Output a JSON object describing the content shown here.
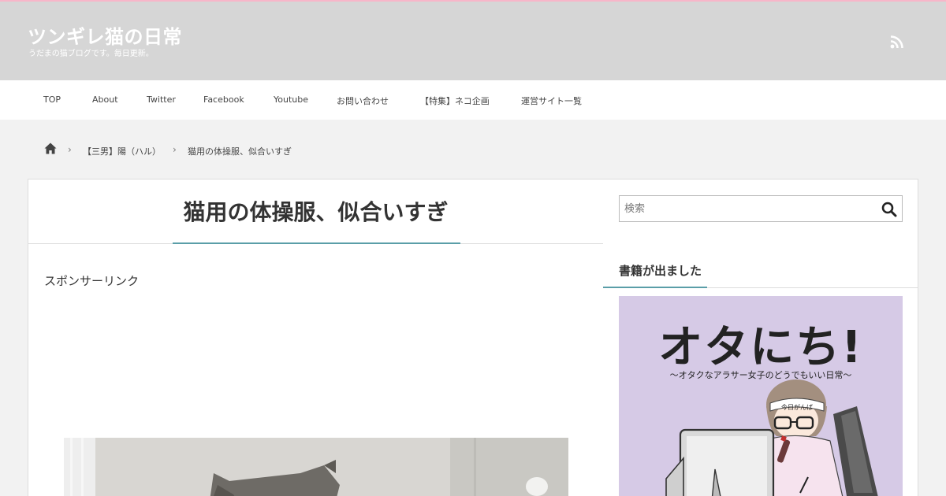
{
  "header": {
    "site_title": "ツンギレ猫の日常",
    "tagline": "うだまの猫ブログです。毎日更新。",
    "rss_icon": "rss-icon",
    "background": "#d6d6d6",
    "accent_pink": "#f7b6c9"
  },
  "nav": {
    "items": [
      {
        "label": "TOP"
      },
      {
        "label": "About"
      },
      {
        "label": "Twitter"
      },
      {
        "label": "Facebook"
      },
      {
        "label": "Youtube"
      },
      {
        "label": "お問い合わせ"
      },
      {
        "label": "【特集】ネコ企画"
      },
      {
        "label": "運営サイト一覧"
      }
    ]
  },
  "breadcrumb": {
    "home_icon": "home-icon",
    "category": "【三男】陽（ハル）",
    "current": "猫用の体操服、似合いすぎ"
  },
  "article": {
    "title": "猫用の体操服、似合いすぎ",
    "sponsor_label": "スポンサーリンク",
    "accent": "#5a9ea8"
  },
  "sidebar": {
    "search_placeholder": "検索",
    "search_icon": "search-icon",
    "widget_title": "書籍が出ました",
    "book": {
      "title": "オタにち!",
      "subtitle": "〜オタクなアラサー女子のどうでもいい日常〜",
      "headband": "今日がんば",
      "background": "#d6cae6"
    }
  }
}
